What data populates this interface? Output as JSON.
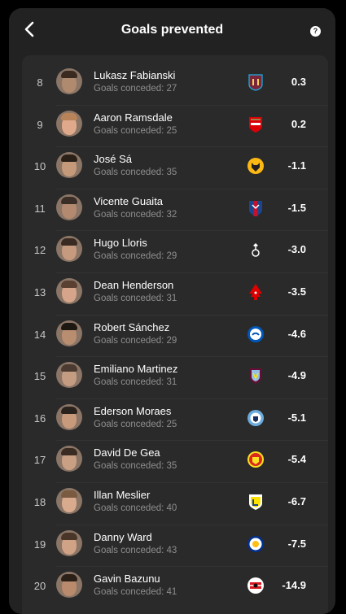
{
  "header": {
    "title": "Goals prevented",
    "help_label": "?"
  },
  "colors": {
    "background": "#000000",
    "sheet": "#222222",
    "list": "#2a2a2a",
    "text_primary": "#ffffff",
    "text_secondary": "#8e8e8e"
  },
  "rows": [
    {
      "rank": "8",
      "name": "Lukasz Fabianski",
      "conceded": "Goals conceded: 27",
      "value": "0.3",
      "club_icon": "west-ham-crest",
      "skin": "#b08a6e",
      "hair": "#3a2a20"
    },
    {
      "rank": "9",
      "name": "Aaron Ramsdale",
      "conceded": "Goals conceded: 25",
      "value": "0.2",
      "club_icon": "arsenal-crest",
      "skin": "#e0a98c",
      "hair": "#b9835a"
    },
    {
      "rank": "10",
      "name": "José Sá",
      "conceded": "Goals conceded: 35",
      "value": "-1.1",
      "club_icon": "wolves-crest",
      "skin": "#c49a7a",
      "hair": "#2a2018"
    },
    {
      "rank": "11",
      "name": "Vicente Guaita",
      "conceded": "Goals conceded: 32",
      "value": "-1.5",
      "club_icon": "crystal-palace-crest",
      "skin": "#b38a70",
      "hair": "#3b2e26"
    },
    {
      "rank": "12",
      "name": "Hugo Lloris",
      "conceded": "Goals conceded: 29",
      "value": "-3.0",
      "club_icon": "tottenham-crest",
      "skin": "#c69a7e",
      "hair": "#3a2b22"
    },
    {
      "rank": "13",
      "name": "Dean Henderson",
      "conceded": "Goals conceded: 31",
      "value": "-3.5",
      "club_icon": "nottingham-forest-crest",
      "skin": "#d5a48a",
      "hair": "#5a4030"
    },
    {
      "rank": "14",
      "name": "Robert Sánchez",
      "conceded": "Goals conceded: 29",
      "value": "-4.6",
      "club_icon": "brighton-crest",
      "skin": "#b88d70",
      "hair": "#1e1812"
    },
    {
      "rank": "15",
      "name": "Emiliano Martinez",
      "conceded": "Goals conceded: 31",
      "value": "-4.9",
      "club_icon": "aston-villa-crest",
      "skin": "#c49c82",
      "hair": "#4a3a30"
    },
    {
      "rank": "16",
      "name": "Ederson Moraes",
      "conceded": "Goals conceded: 25",
      "value": "-5.1",
      "club_icon": "manchester-city-crest",
      "skin": "#c89a7c",
      "hair": "#2a221c"
    },
    {
      "rank": "17",
      "name": "David De Gea",
      "conceded": "Goals conceded: 35",
      "value": "-5.4",
      "club_icon": "manchester-united-crest",
      "skin": "#c9a084",
      "hair": "#3a2c22"
    },
    {
      "rank": "18",
      "name": "Illan Meslier",
      "conceded": "Goals conceded: 40",
      "value": "-6.7",
      "club_icon": "leeds-crest",
      "skin": "#d8aa8e",
      "hair": "#7a5a40"
    },
    {
      "rank": "19",
      "name": "Danny Ward",
      "conceded": "Goals conceded: 43",
      "value": "-7.5",
      "club_icon": "leicester-crest",
      "skin": "#d0a286",
      "hair": "#4a3628"
    },
    {
      "rank": "20",
      "name": "Gavin Bazunu",
      "conceded": "Goals conceded: 41",
      "value": "-14.9",
      "club_icon": "southampton-crest",
      "skin": "#b98a6c",
      "hair": "#2a2018"
    }
  ]
}
